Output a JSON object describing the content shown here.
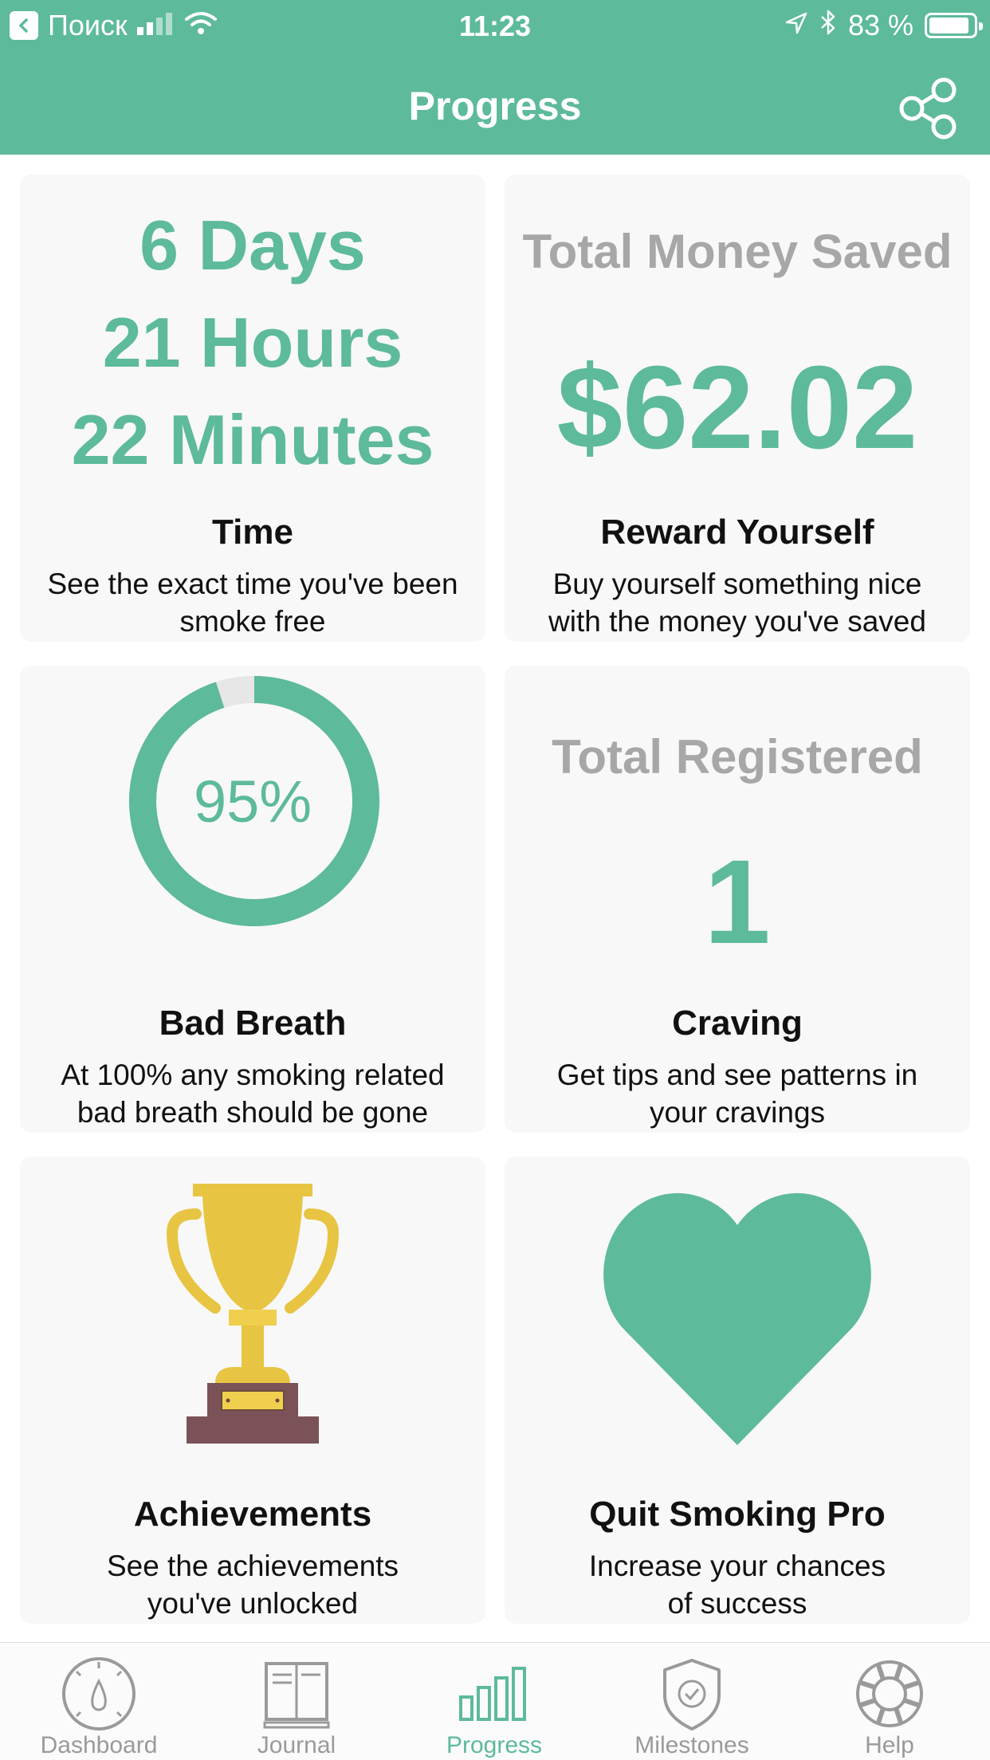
{
  "status_bar": {
    "back_label": "Поиск",
    "time": "11:23",
    "battery": "83 %"
  },
  "nav": {
    "title": "Progress"
  },
  "cards": {
    "time": {
      "days": "6 Days",
      "hours": "21 Hours",
      "minutes": "22 Minutes",
      "title": "Time",
      "desc_line1": "See the exact time you've been",
      "desc_line2": "smoke free"
    },
    "money": {
      "heading": "Total Money Saved",
      "amount": "$62.02",
      "title": "Reward Yourself",
      "desc_line1": "Buy yourself something nice",
      "desc_line2": "with the money you've saved"
    },
    "breath": {
      "percent_label": "95%",
      "progress": 0.95,
      "title": "Bad Breath",
      "desc_line1": "At 100% any smoking related",
      "desc_line2": "bad breath should be gone"
    },
    "craving": {
      "heading": "Total Registered",
      "count": "1",
      "title": "Craving",
      "desc_line1": "Get tips and see patterns in",
      "desc_line2": "your cravings"
    },
    "achievements": {
      "title": "Achievements",
      "desc_line1": "See the achievements",
      "desc_line2": "you've unlocked"
    },
    "pro": {
      "title": "Quit Smoking Pro",
      "desc_line1": "Increase your chances",
      "desc_line2": "of success"
    }
  },
  "tabs": [
    {
      "label": "Dashboard",
      "icon": "dashboard-icon"
    },
    {
      "label": "Journal",
      "icon": "journal-icon"
    },
    {
      "label": "Progress",
      "icon": "progress-icon"
    },
    {
      "label": "Milestones",
      "icon": "milestones-icon"
    },
    {
      "label": "Help",
      "icon": "help-icon"
    }
  ],
  "colors": {
    "accent": "#5dba9b",
    "card_bg": "#f8f8f8",
    "heading_grey": "#a7a7a7",
    "trophy_gold": "#e8c443",
    "trophy_base": "#7a5257"
  }
}
